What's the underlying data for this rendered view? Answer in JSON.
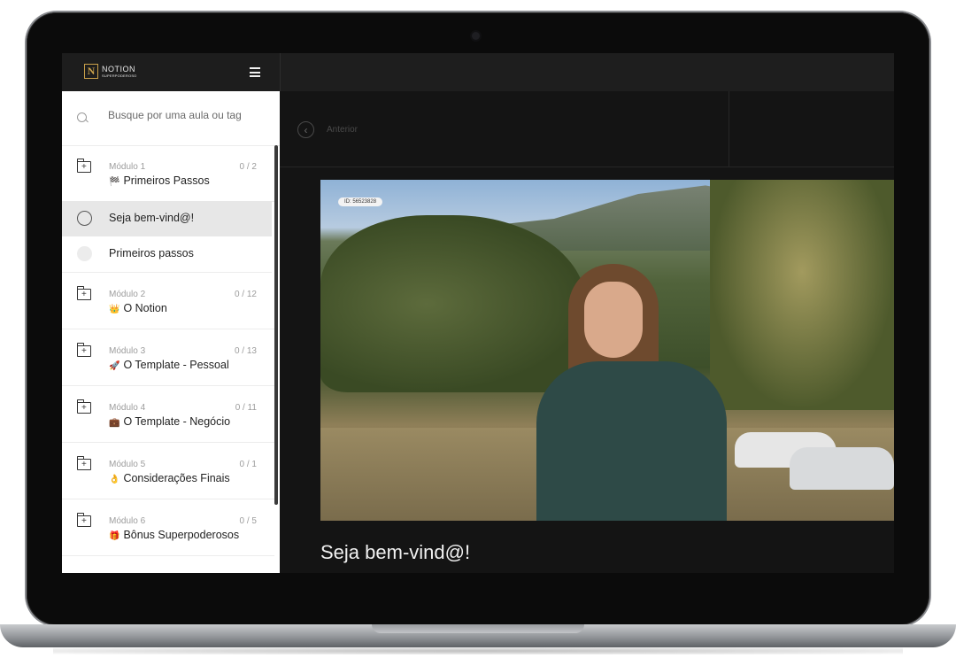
{
  "brand": {
    "logo_letter": "N",
    "name": "NOTION",
    "tagline": "SUPERPODEROSO"
  },
  "search": {
    "placeholder": "Busque por uma aula ou tag"
  },
  "modules": [
    {
      "label": "Módulo 1",
      "count": "0 / 2",
      "emoji": "🏁",
      "title": "Primeiros Passos"
    },
    {
      "label": "Módulo 2",
      "count": "0 / 12",
      "emoji": "👑",
      "title": "O Notion"
    },
    {
      "label": "Módulo 3",
      "count": "0 / 13",
      "emoji": "🚀",
      "title": "O Template - Pessoal"
    },
    {
      "label": "Módulo 4",
      "count": "0 / 11",
      "emoji": "💼",
      "title": "O Template - Negócio"
    },
    {
      "label": "Módulo 5",
      "count": "0 / 1",
      "emoji": "👌",
      "title": "Considerações Finais"
    },
    {
      "label": "Módulo 6",
      "count": "0 / 5",
      "emoji": "🎁",
      "title": "Bônus Superpoderosos"
    }
  ],
  "lessons": [
    {
      "title": "Seja bem-vind@!",
      "active": true
    },
    {
      "title": "Primeiros passos",
      "active": false
    }
  ],
  "nav": {
    "previous_label": "Anterior"
  },
  "video": {
    "id_badge": "ID: 56523828"
  },
  "lesson_heading": "Seja bem-vind@!"
}
